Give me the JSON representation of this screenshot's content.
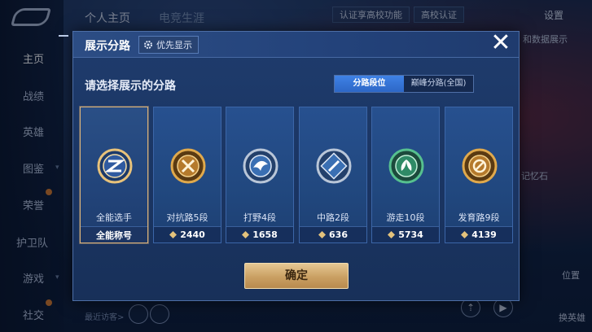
{
  "background": {
    "nav_items": [
      {
        "label": "主页",
        "active": true
      },
      {
        "label": "战绩",
        "active": false
      },
      {
        "label": "英雄",
        "active": false
      },
      {
        "label": "图鉴",
        "active": false
      },
      {
        "label": "荣誉",
        "active": false
      },
      {
        "label": "护卫队",
        "active": false
      },
      {
        "label": "游戏",
        "active": false
      },
      {
        "label": "社交",
        "active": false
      }
    ],
    "top_tabs": [
      "个人主页",
      "电竞生涯"
    ],
    "campus_feature": "认证享高校功能",
    "campus_auth": "高校认证",
    "settings": "设置",
    "right_labels": [
      "和数据展示",
      "记忆石",
      "位置",
      "换英雄"
    ],
    "recent_visitors": "最近访客>"
  },
  "dialog": {
    "title": "展示分路",
    "priority_button": "优先显示",
    "close_icon": "close-icon",
    "prompt": "请选择展示的分路",
    "segments": [
      {
        "label": "分路段位",
        "active": true
      },
      {
        "label": "巅峰分路(全国)",
        "active": false
      }
    ],
    "lanes": [
      {
        "name": "全能选手",
        "footer": "全能称号",
        "selected": true,
        "power": null,
        "badge_color": "#e8c27a",
        "emblem": "cross"
      },
      {
        "name": "对抗路5段",
        "footer": "2440",
        "selected": false,
        "power": true,
        "badge_color": "#e0a94c",
        "emblem": "x"
      },
      {
        "name": "打野4段",
        "footer": "1658",
        "selected": false,
        "power": true,
        "badge_color": "#b9c6d8",
        "emblem": "wing"
      },
      {
        "name": "中路2段",
        "footer": "636",
        "selected": false,
        "power": true,
        "badge_color": "#b9c6d8",
        "emblem": "slash"
      },
      {
        "name": "游走10段",
        "footer": "5734",
        "selected": false,
        "power": true,
        "badge_color": "#56c08f",
        "emblem": "leaf"
      },
      {
        "name": "发育路9段",
        "footer": "4139",
        "selected": false,
        "power": true,
        "badge_color": "#e0a94c",
        "emblem": "ban"
      }
    ],
    "confirm_button": "确定"
  },
  "colors": {
    "accent_gold": "#caa063",
    "segment_active": "#3f82e6",
    "power_icon": "#e3c27c"
  }
}
